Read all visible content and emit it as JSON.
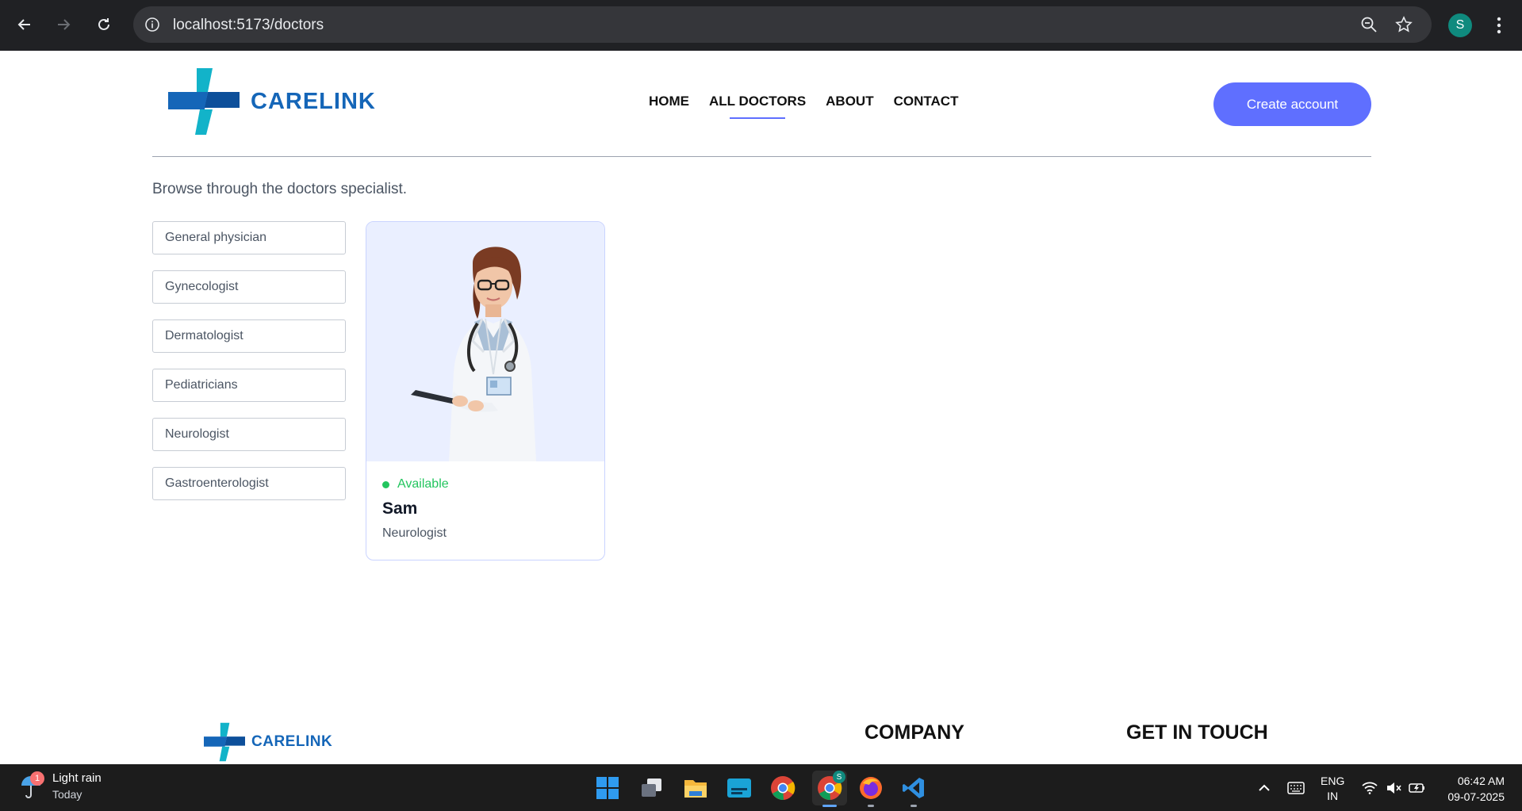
{
  "browser": {
    "url": "localhost:5173/doctors",
    "profile_initial": "S"
  },
  "site": {
    "brand": "CARELINK",
    "nav": [
      "HOME",
      "ALL DOCTORS",
      "ABOUT",
      "CONTACT"
    ],
    "active_nav": "ALL DOCTORS",
    "create_account": "Create account",
    "brand_blue": "#1566b8",
    "brand_teal": "#12b3c9",
    "accent": "#5f6fff"
  },
  "page": {
    "subtitle": "Browse through the doctors specialist.",
    "specialities": [
      "General physician",
      "Gynecologist",
      "Dermatologist",
      "Pediatricians",
      "Neurologist",
      "Gastroenterologist"
    ]
  },
  "doctor": {
    "status": "Available",
    "name": "Sam",
    "speciality": "Neurologist"
  },
  "footer": {
    "brand": "CARELINK",
    "company_heading": "COMPANY",
    "contact_heading": "GET IN TOUCH"
  },
  "taskbar": {
    "weather": "Light rain",
    "weather_sub": "Today",
    "weather_badge": "1",
    "lang_1": "ENG",
    "lang_2": "IN",
    "time": "06:42 AM",
    "date": "09-07-2025",
    "chrome_badge": "S"
  }
}
